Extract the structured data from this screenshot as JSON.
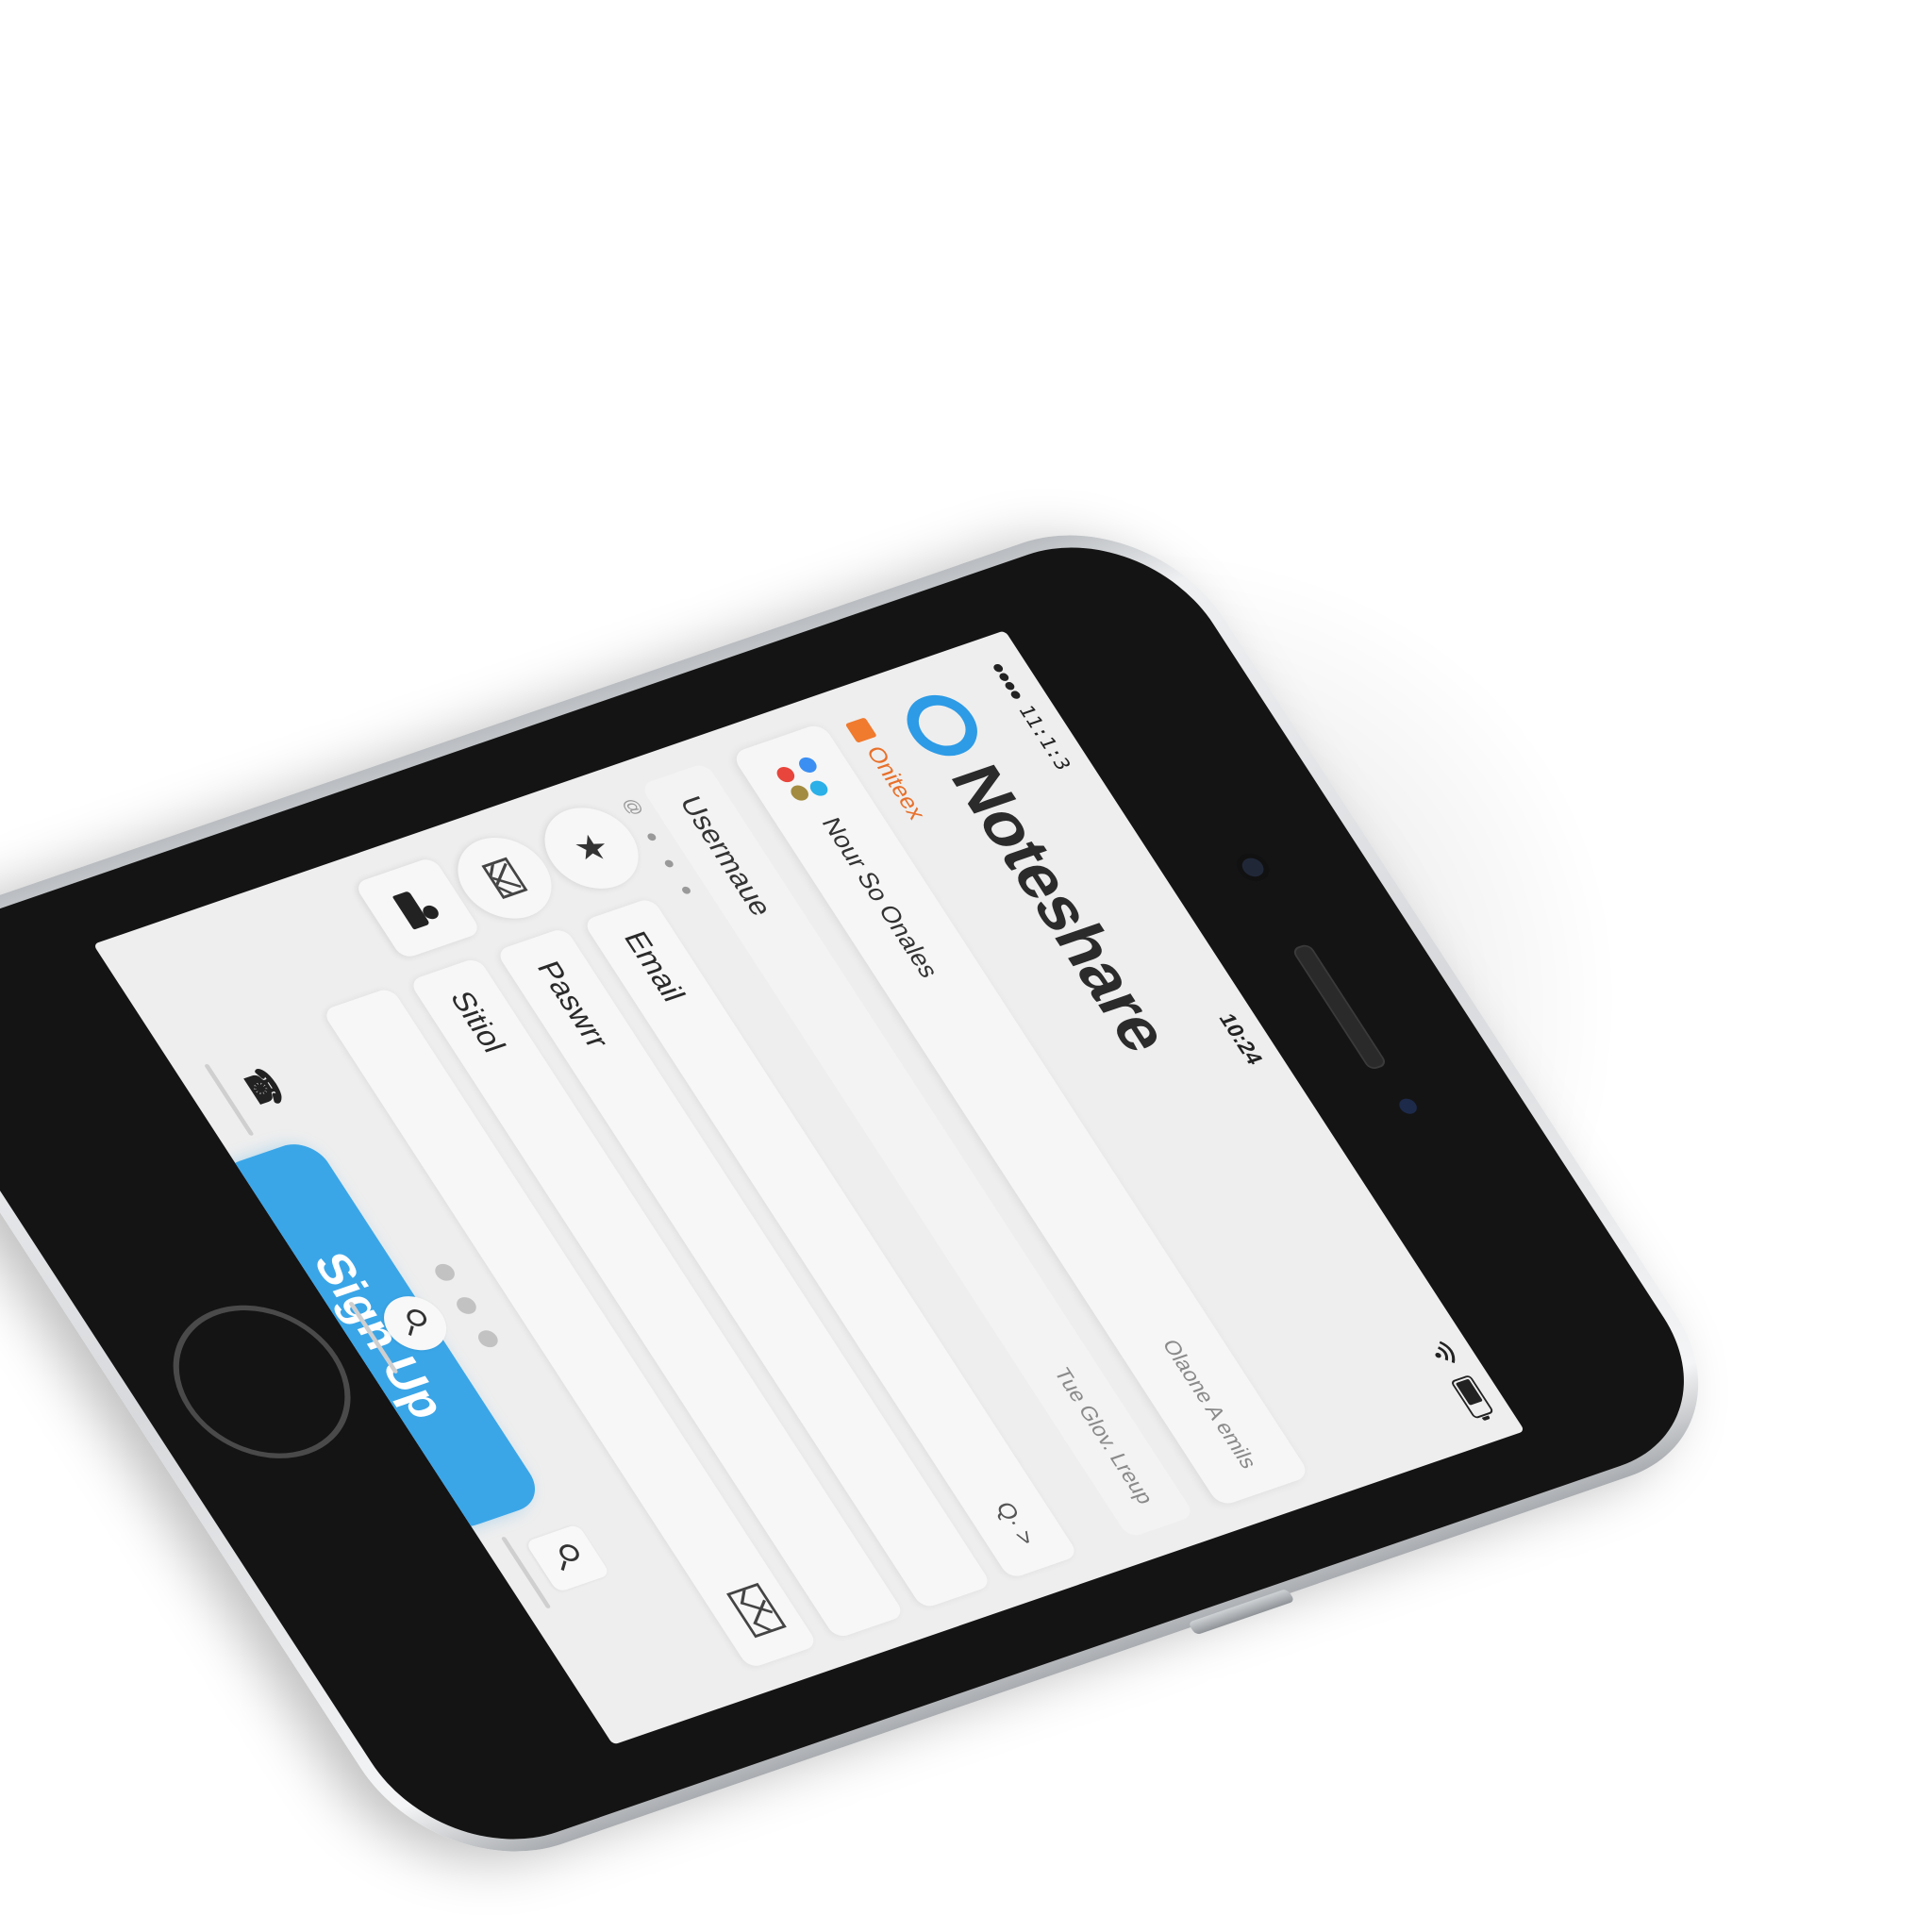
{
  "status_bar": {
    "signal": "●●●●",
    "carrier": "11:1:3",
    "time": "10:24",
    "wifi": "wifi-icon",
    "battery": "battery-icon"
  },
  "brand": {
    "name": "Noteshare",
    "logo_color": "#2d9be6"
  },
  "tag": {
    "label": "Oniteex",
    "color": "#f07a2e"
  },
  "social_card": {
    "label": "Nour So Onales",
    "hint": "Olaone A emils"
  },
  "username": {
    "label": "Usermaue",
    "hint": "Tue Glov. Lreup"
  },
  "mini_dots": "@ ● ● ●",
  "fields": {
    "email_label": "Email",
    "email_trail": "Q· >",
    "password_label": "Paswrr",
    "extra_label": "Sitiol"
  },
  "icons": {
    "star": "star-icon",
    "mail": "mail-icon",
    "user": "user-icon"
  },
  "signup": {
    "label": "Sign Up",
    "color": "#3aa6e8"
  },
  "tabbar": {
    "items": [
      {
        "icon": "phone-icon",
        "glyph": "☎"
      },
      {
        "icon": "search-icon"
      },
      {
        "icon": "search-icon"
      }
    ]
  }
}
